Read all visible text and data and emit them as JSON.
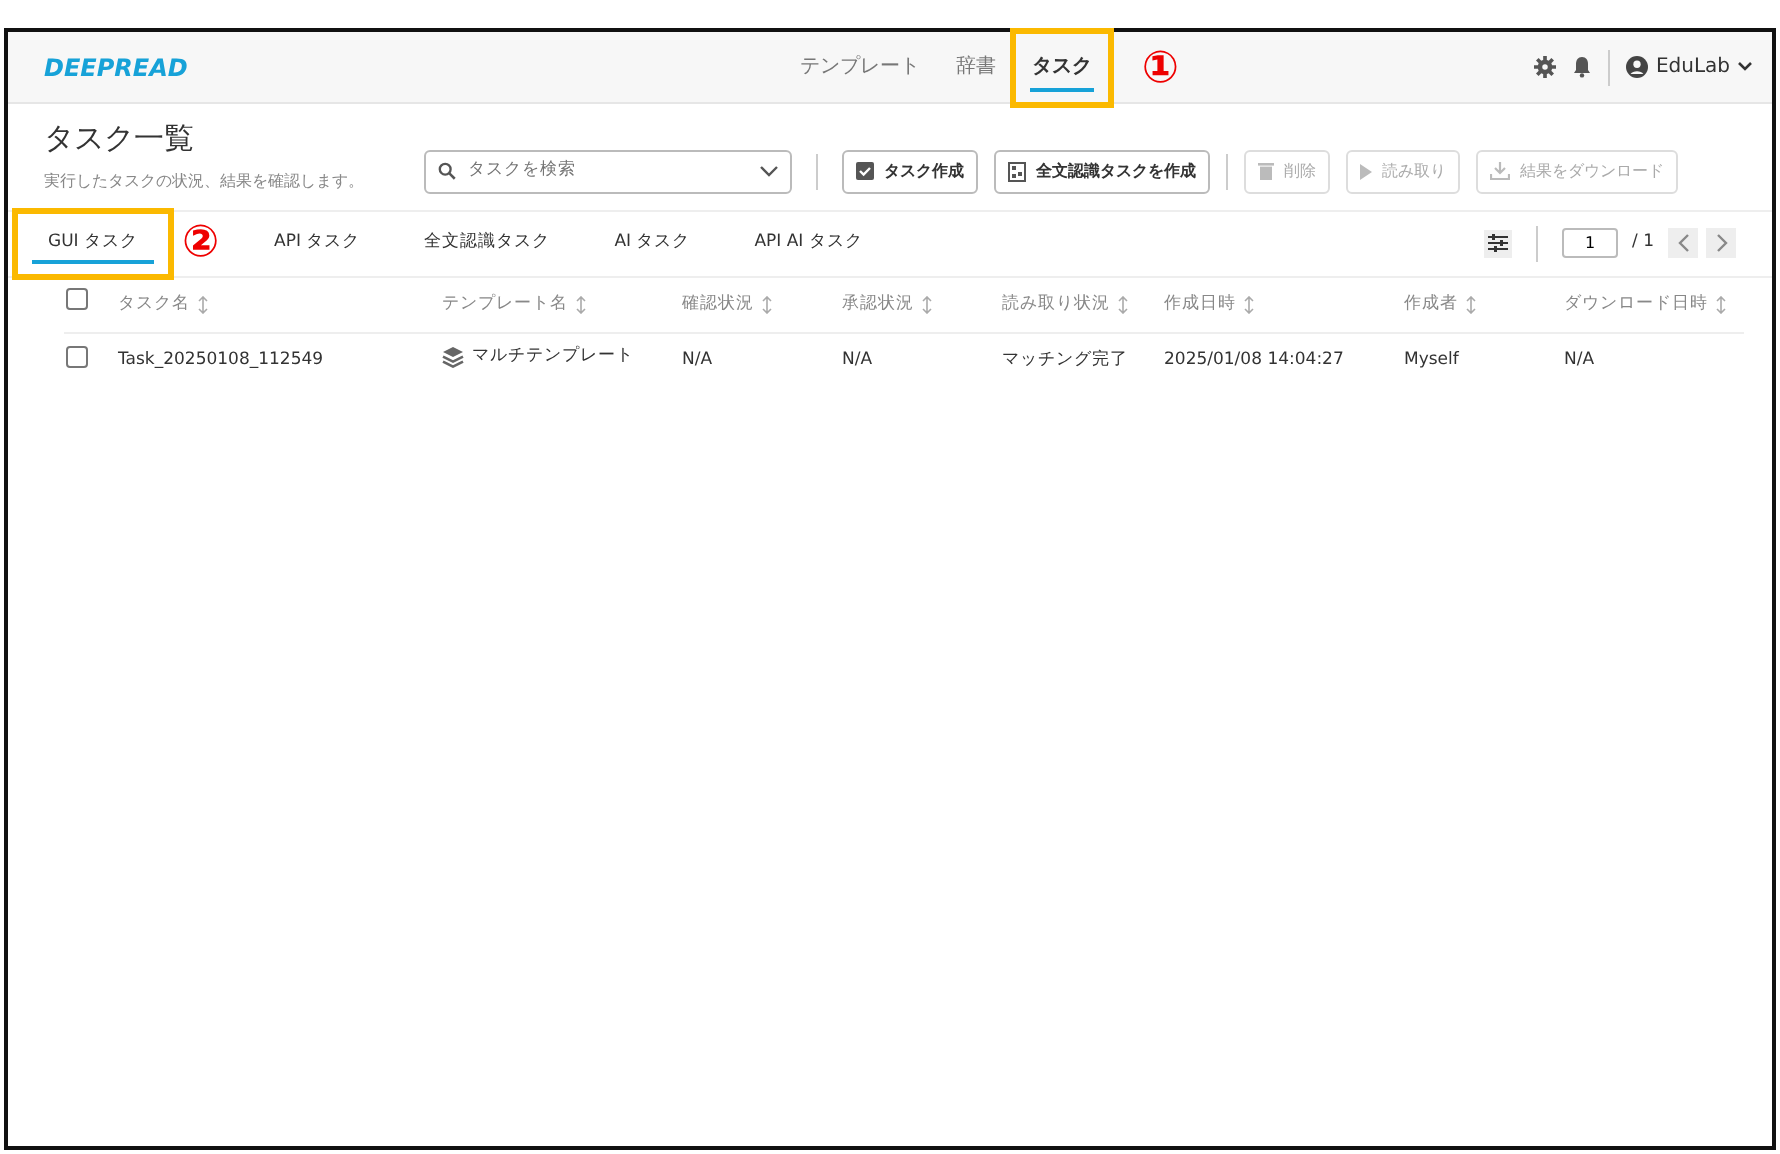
{
  "navbar": {
    "logo": "DEEPREAD",
    "items": [
      {
        "label": "テンプレート",
        "selected": false,
        "highlighted": false
      },
      {
        "label": "辞書",
        "selected": false,
        "highlighted": false
      },
      {
        "label": "タスク",
        "selected": true,
        "highlighted": true,
        "marker": "①"
      }
    ],
    "user": "EduLab"
  },
  "page": {
    "title": "タスク一覧",
    "subtitle": "実行したタスクの状況、結果を確認します。"
  },
  "search": {
    "placeholder": "タスクを検索"
  },
  "buttons": [
    {
      "kind": "check",
      "label": "タスク作成",
      "disabled": false
    },
    {
      "kind": "scan",
      "label": "全文認識タスクを作成",
      "disabled": false
    },
    {
      "kind": "trash",
      "label": "削除",
      "disabled": true
    },
    {
      "kind": "play",
      "label": "読み取り",
      "disabled": true
    },
    {
      "kind": "download",
      "label": "結果をダウンロード",
      "disabled": true
    }
  ],
  "tabs": [
    {
      "label": "GUI タスク",
      "selected": true,
      "highlighted": true,
      "marker": "②"
    },
    {
      "label": "API タスク",
      "selected": false,
      "highlighted": false
    },
    {
      "label": "全文認識タスク",
      "selected": false,
      "highlighted": false
    },
    {
      "label": "AI タスク",
      "selected": false,
      "highlighted": false
    },
    {
      "label": "API AI タスク",
      "selected": false,
      "highlighted": false
    }
  ],
  "pagination": {
    "page": "1",
    "total": "/ 1"
  },
  "table": {
    "select_all_checked": false,
    "columns": [
      "タスク名",
      "テンプレート名",
      "確認状況",
      "承認状況",
      "読み取り状況",
      "作成日時",
      "作成者",
      "ダウンロード日時"
    ],
    "rows": [
      {
        "checked": false,
        "cells": [
          "Task_20250108_112549",
          "マルチテンプレート",
          "N/A",
          "N/A",
          "マッチング完了",
          "2025/01/08 14:04:27",
          "Myself",
          "N/A"
        ]
      }
    ]
  }
}
